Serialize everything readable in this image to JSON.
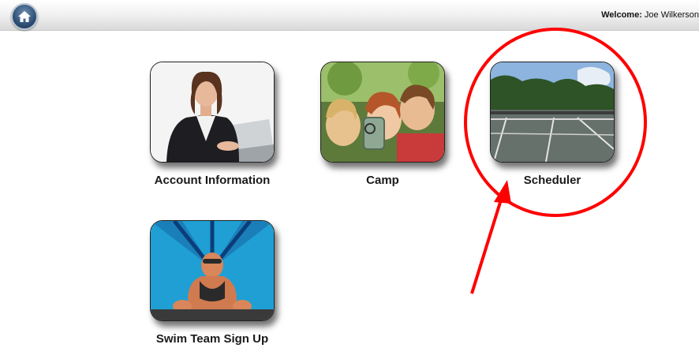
{
  "header": {
    "welcome_prefix": "Welcome:",
    "user_name": "Joe Wilkerson",
    "home_icon": "home-icon"
  },
  "tiles": [
    {
      "label": "Account Information",
      "image": "businesswoman-photo"
    },
    {
      "label": "Camp",
      "image": "kids-with-jar-photo"
    },
    {
      "label": "Scheduler",
      "image": "tennis-courts-photo"
    },
    {
      "label": "Swim Team Sign Up",
      "image": "swimmer-photo"
    }
  ],
  "annotation": {
    "color": "#ff0000",
    "shapes": [
      "circle-highlight",
      "arrow"
    ]
  }
}
